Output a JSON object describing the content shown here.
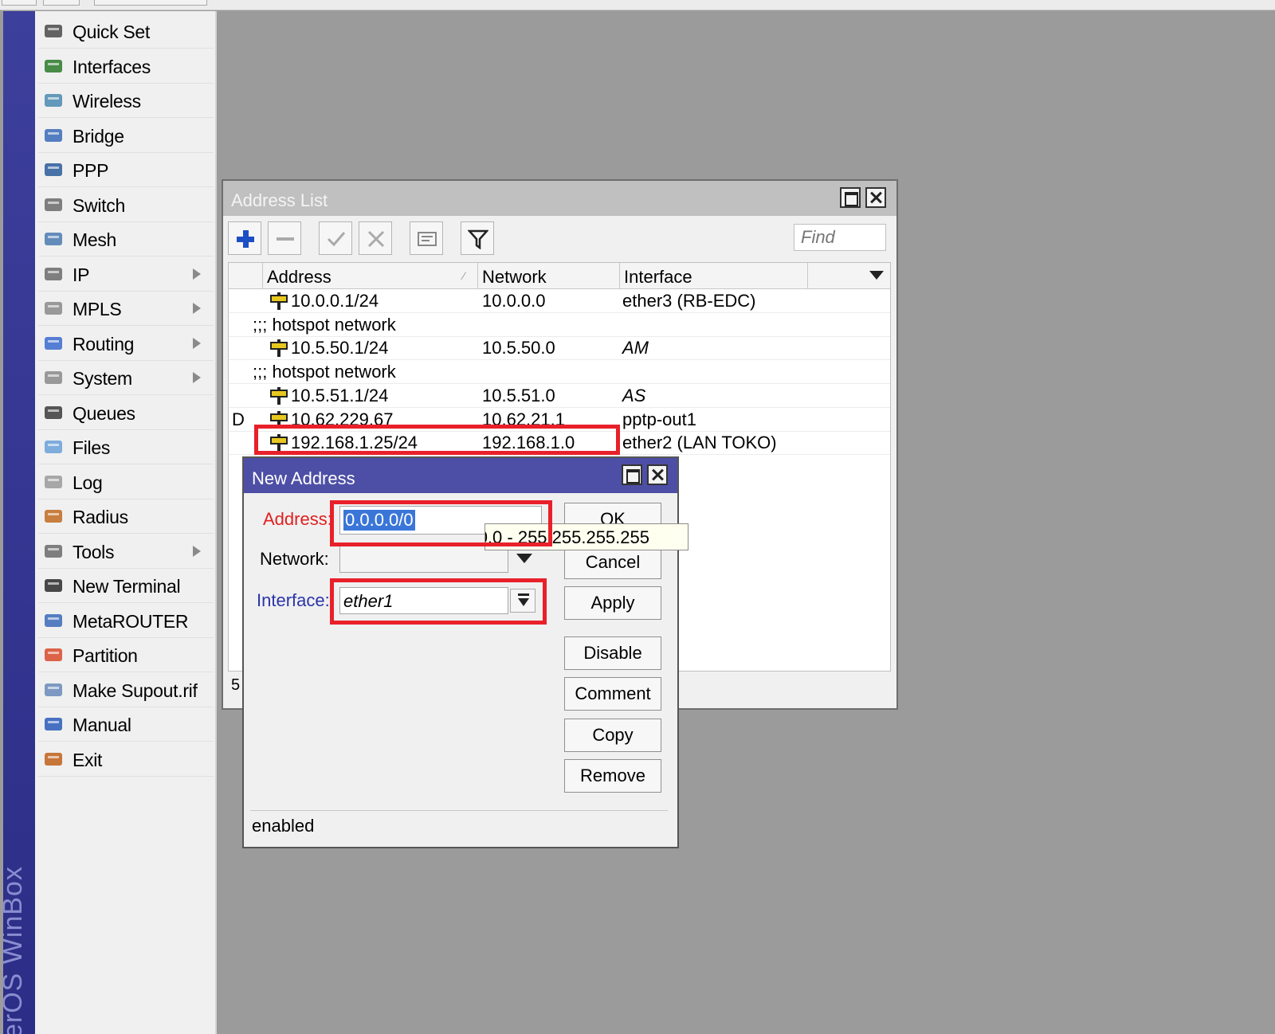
{
  "app": {
    "brand_vertical": "erOS WinBox"
  },
  "sidebar": {
    "items": [
      {
        "label": "Quick Set",
        "icon": "quick-set-icon",
        "submenu": false
      },
      {
        "label": "Interfaces",
        "icon": "interfaces-icon",
        "submenu": false
      },
      {
        "label": "Wireless",
        "icon": "wireless-icon",
        "submenu": false
      },
      {
        "label": "Bridge",
        "icon": "bridge-icon",
        "submenu": false
      },
      {
        "label": "PPP",
        "icon": "ppp-icon",
        "submenu": false
      },
      {
        "label": "Switch",
        "icon": "switch-icon",
        "submenu": false
      },
      {
        "label": "Mesh",
        "icon": "mesh-icon",
        "submenu": false
      },
      {
        "label": "IP",
        "icon": "ip-icon",
        "submenu": true
      },
      {
        "label": "MPLS",
        "icon": "mpls-icon",
        "submenu": true
      },
      {
        "label": "Routing",
        "icon": "routing-icon",
        "submenu": true
      },
      {
        "label": "System",
        "icon": "system-gear-icon",
        "submenu": true
      },
      {
        "label": "Queues",
        "icon": "queues-icon",
        "submenu": false
      },
      {
        "label": "Files",
        "icon": "folder-icon",
        "submenu": false
      },
      {
        "label": "Log",
        "icon": "log-icon",
        "submenu": false
      },
      {
        "label": "Radius",
        "icon": "radius-users-icon",
        "submenu": false
      },
      {
        "label": "Tools",
        "icon": "tools-icon",
        "submenu": true
      },
      {
        "label": "New Terminal",
        "icon": "terminal-icon",
        "submenu": false
      },
      {
        "label": "MetaROUTER",
        "icon": "metarouter-icon",
        "submenu": false
      },
      {
        "label": "Partition",
        "icon": "partition-icon",
        "submenu": false
      },
      {
        "label": "Make Supout.rif",
        "icon": "supout-file-icon",
        "submenu": false
      },
      {
        "label": "Manual",
        "icon": "help-icon",
        "submenu": false
      },
      {
        "label": "Exit",
        "icon": "exit-door-icon",
        "submenu": false
      }
    ]
  },
  "address_list": {
    "title": "Address List",
    "find_placeholder": "Find",
    "columns": [
      "Address",
      "Network",
      "Interface"
    ],
    "rows": [
      {
        "flag": "",
        "kind": "entry",
        "address": "10.0.0.1/24",
        "network": "10.0.0.0",
        "interface": "ether3 (RB-EDC)",
        "italic": false
      },
      {
        "kind": "comment",
        "text": ";;; hotspot network"
      },
      {
        "flag": "",
        "kind": "entry",
        "address": "10.5.50.1/24",
        "network": "10.5.50.0",
        "interface": "AM",
        "italic": true
      },
      {
        "kind": "comment",
        "text": ";;; hotspot network"
      },
      {
        "flag": "",
        "kind": "entry",
        "address": "10.5.51.1/24",
        "network": "10.5.51.0",
        "interface": "AS",
        "italic": true
      },
      {
        "flag": "D",
        "kind": "entry",
        "address": "10.62.229.67",
        "network": "10.62.21.1",
        "interface": "pptp-out1",
        "italic": false
      },
      {
        "flag": "",
        "kind": "entry",
        "address": "192.168.1.25/24",
        "network": "192.168.1.0",
        "interface": "ether2 (LAN TOKO)",
        "italic": false
      }
    ],
    "status_count": "5"
  },
  "new_address": {
    "title": "New Address",
    "address_label": "Address:",
    "address_value": "0.0.0.0/0",
    "network_label": "Network:",
    "network_value": "",
    "interface_label": "Interface:",
    "interface_value": "ether1",
    "tooltip": "0.0.0.0 - 255.255.255.255",
    "buttons": {
      "ok": "OK",
      "cancel": "Cancel",
      "apply": "Apply",
      "disable": "Disable",
      "comment": "Comment",
      "copy": "Copy",
      "remove": "Remove"
    },
    "status": "enabled"
  },
  "colors": {
    "highlight_red": "#e8202a",
    "dialog_title": "#4d4fa6",
    "sidebar_strip": "#2b2d86",
    "selection_blue": "#3a76d8"
  }
}
